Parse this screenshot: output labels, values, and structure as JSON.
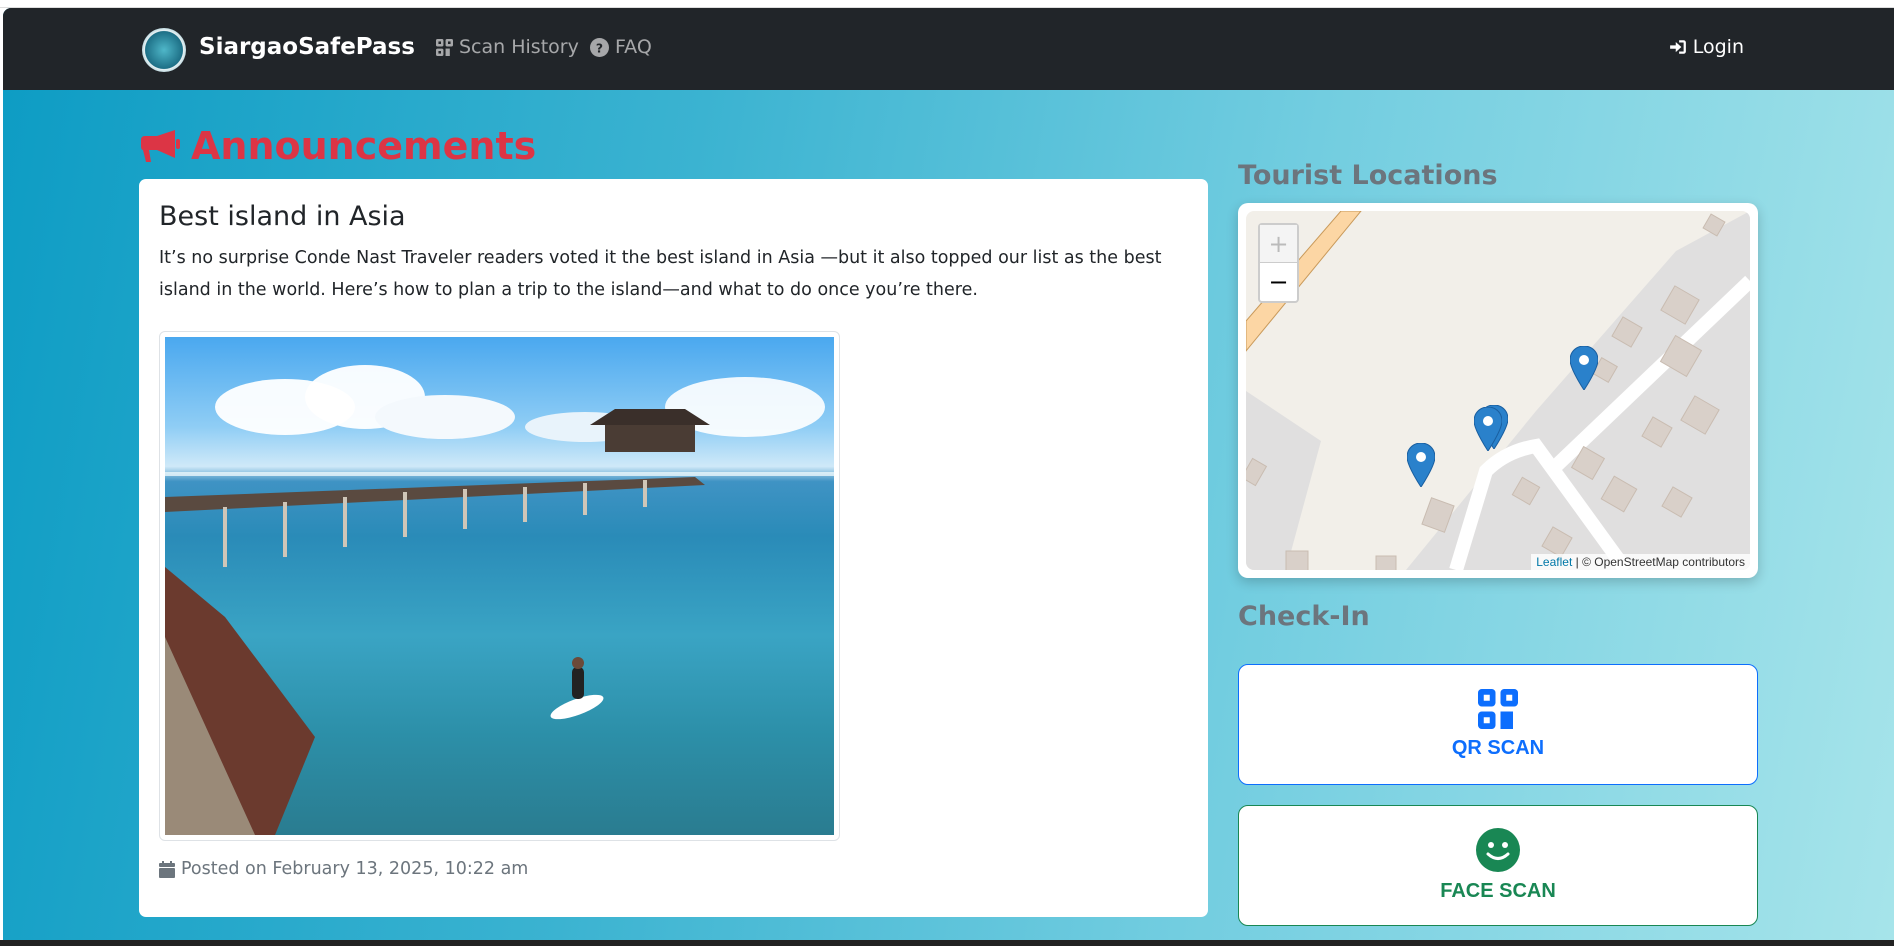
{
  "nav": {
    "brand": "SiargaoSafePass",
    "links": [
      {
        "label": "Scan History",
        "icon": "qr-code-icon"
      },
      {
        "label": "FAQ",
        "icon": "question-circle-icon"
      }
    ],
    "login": {
      "label": "Login",
      "icon": "sign-in-icon"
    }
  },
  "announcements": {
    "heading": "Announcements",
    "icon": "bullhorn-icon",
    "post": {
      "title": "Best island in Asia",
      "body": "It’s no surprise Conde Nast Traveler readers voted it the best island in Asia —but it also topped our list as the best island in the world. Here’s how to plan a trip to the island—and what to do once you’re there.",
      "posted": "Posted on February 13, 2025, 10:22 am"
    }
  },
  "map": {
    "heading": "Tourist Locations",
    "zoom_in": "+",
    "zoom_out": "−",
    "attribution_link": "Leaflet",
    "attribution_text": "| © OpenStreetMap contributors",
    "marker_count": 4
  },
  "checkin": {
    "heading": "Check-In",
    "qr_label": "QR SCAN",
    "face_label": "FACE SCAN"
  },
  "colors": {
    "navbar": "#212529",
    "announcement": "#dc3545",
    "primary": "#0d6efd",
    "success": "#198754",
    "muted": "#6c757d"
  }
}
